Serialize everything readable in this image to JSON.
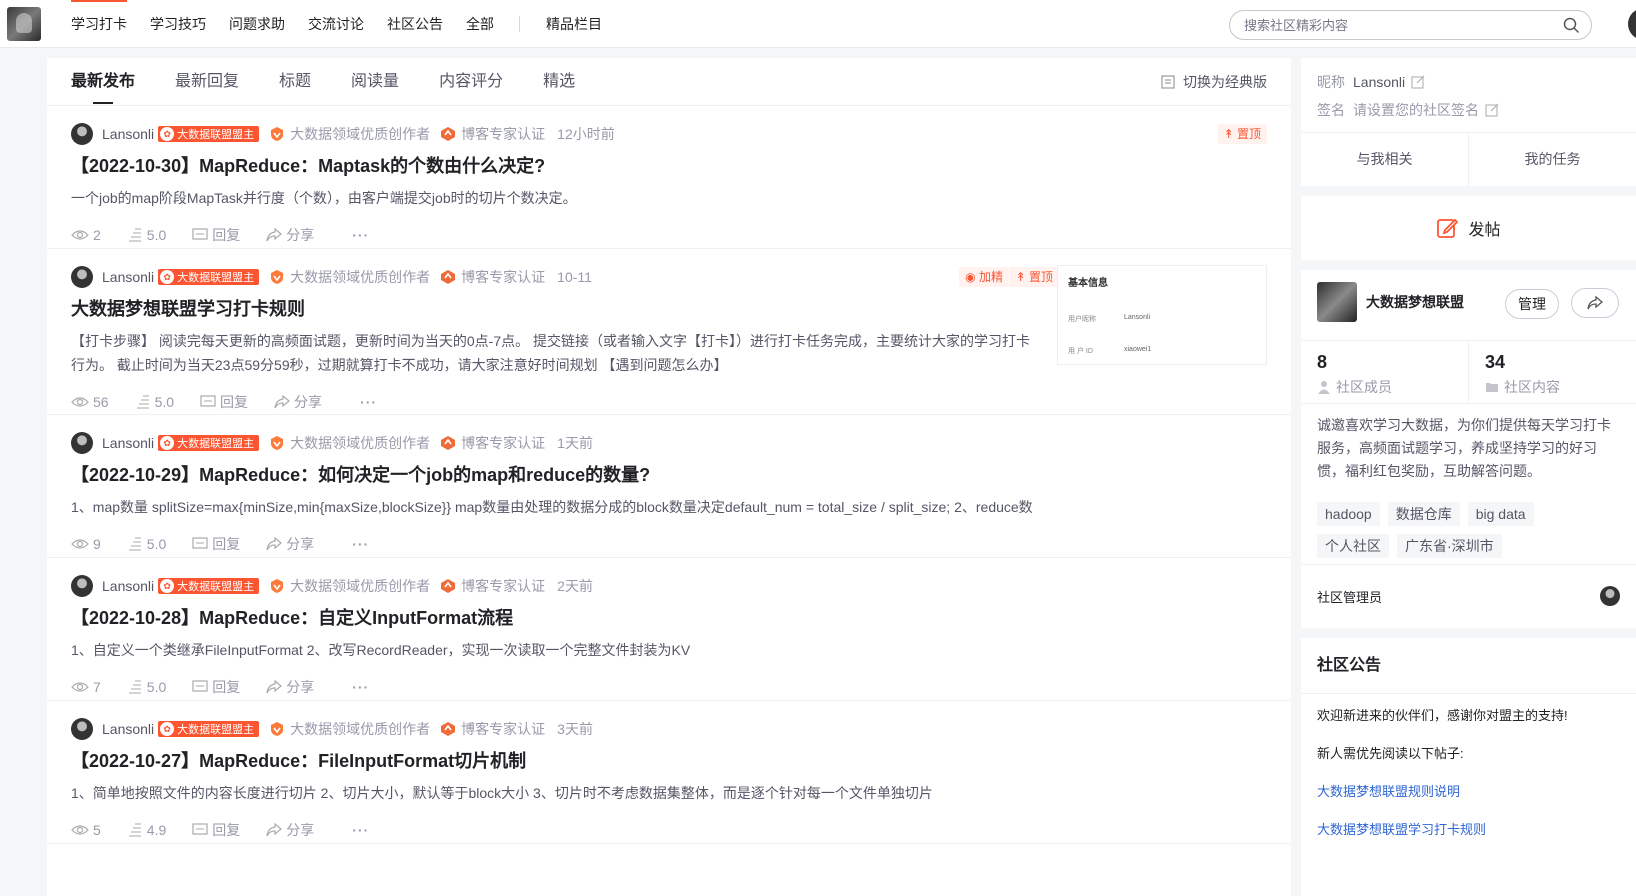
{
  "topnav": {
    "items": [
      "学习打卡",
      "学习技巧",
      "问题求助",
      "交流讨论",
      "社区公告",
      "全部"
    ],
    "extra": "精品栏目",
    "search_placeholder": "搜索社区精彩内容"
  },
  "tabs": {
    "items": [
      "最新发布",
      "最新回复",
      "标题",
      "阅读量",
      "内容评分",
      "精选"
    ],
    "switch_label": "切换为经典版"
  },
  "badges": {
    "leader": "大数据联盟盟主",
    "cert1": "大数据领域优质创作者",
    "cert2": "博客专家认证",
    "top": "置顶",
    "featured": "加精"
  },
  "actions": {
    "reply": "回复",
    "share": "分享",
    "more": "···"
  },
  "posts": [
    {
      "author": "Lansonli",
      "time": "12小时前",
      "title": "【2022-10-30】MapReduce：Maptask的个数由什么决定?",
      "desc": "一个job的map阶段MapTask并行度（个数），由客户端提交job时的切片个数决定。",
      "views": "2",
      "score": "5.0"
    },
    {
      "author": "Lansonli",
      "time": "10-11",
      "title": "大数据梦想联盟学习打卡规则",
      "desc": "【打卡步骤】 阅读完每天更新的高频面试题，更新时间为当天的0点-7点。 提交链接（或者输入文字【打卡】）进行打卡任务完成，主要统计大家的学习打卡行为。 截止时间为当天23点59分59秒，过期就算打卡不成功，请大家注意好时间规划 【遇到问题怎么办】",
      "views": "56",
      "score": "5.0"
    },
    {
      "author": "Lansonli",
      "time": "1天前",
      "title": "【2022-10-29】MapReduce：如何决定一个job的map和reduce的数量?",
      "desc": "1、map数量 splitSize=max{minSize,min{maxSize,blockSize}} map数量由处理的数据分成的block数量决定default_num = total_size / split_size; 2、reduce数",
      "views": "9",
      "score": "5.0"
    },
    {
      "author": "Lansonli",
      "time": "2天前",
      "title": "【2022-10-28】MapReduce：自定义InputFormat流程",
      "desc": "1、自定义一个类继承FileInputFormat 2、改写RecordReader，实现一次读取一个完整文件封装为KV",
      "views": "7",
      "score": "5.0"
    },
    {
      "author": "Lansonli",
      "time": "3天前",
      "title": "【2022-10-27】MapReduce：FileInputFormat切片机制",
      "desc": "1、简单地按照文件的内容长度进行切片 2、切片大小，默认等于block大小 3、切片时不考虑数据集整体，而是逐个针对每一个文件单独切片",
      "views": "5",
      "score": "4.9"
    }
  ],
  "thumb": {
    "title": "基本信息",
    "row1_label": "用户昵称",
    "row1_value": "Lansonli",
    "row2_label": "用 户 ID",
    "row2_value": "xiaowei1"
  },
  "profile": {
    "nick_label": "昵称",
    "nick": "Lansonli",
    "sign_label": "签名",
    "sign": "请设置您的社区签名",
    "tab1": "与我相关",
    "tab2": "我的任务",
    "post_button": "发帖"
  },
  "community": {
    "name": "大数据梦想联盟",
    "manage": "管理",
    "members": "8",
    "members_label": "社区成员",
    "contents": "34",
    "contents_label": "社区内容",
    "desc": "诚邀喜欢学习大数据，为你们提供每天学习打卡服务，高频面试题学习，养成坚持学习的好习惯，福利红包奖励，互助解答问题。",
    "tags": [
      "hadoop",
      "数据仓库",
      "big data",
      "个人社区",
      "广东省·深圳市"
    ],
    "admin_label": "社区管理员"
  },
  "notice": {
    "title": "社区公告",
    "line1": "欢迎新进来的伙伴们，感谢你对盟主的支持!",
    "line2": "新人需优先阅读以下帖子:",
    "link1": "大数据梦想联盟规则说明",
    "link2": "大数据梦想联盟学习打卡规则"
  },
  "colors": {
    "accent": "#fc5531",
    "link": "#2e66d4"
  }
}
